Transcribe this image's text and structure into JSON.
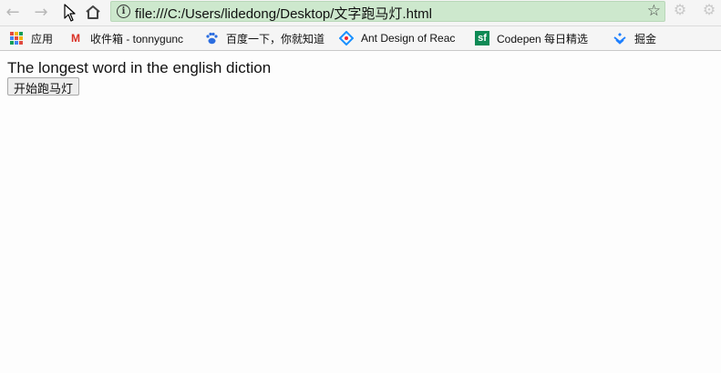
{
  "browser": {
    "url": "file:///C:/Users/lidedong/Desktop/文字跑马灯.html",
    "icons": {
      "back": "arrow-left-icon",
      "forward": "arrow-right-icon",
      "reload": "reload-icon",
      "home": "home-icon",
      "info": "info-icon",
      "star": "star-icon",
      "extension": "gear-icon"
    }
  },
  "bookmarks": [
    {
      "label": "应用",
      "icon": "apps-grid-icon"
    },
    {
      "label": "收件箱 - tonnygunc",
      "icon": "gmail-icon",
      "icon_text": "M",
      "icon_color": "#d93025"
    },
    {
      "label": "百度一下，你就知道",
      "icon": "baidu-paw-icon",
      "icon_color": "#2b6de0"
    },
    {
      "label": "Ant Design of Reac",
      "icon": "ant-design-icon",
      "icon_color": "#1890ff"
    },
    {
      "label": "Codepen 每日精选",
      "icon": "sf-icon",
      "icon_text": "sf",
      "icon_color": "#0e8a55"
    },
    {
      "label": "掘金",
      "icon": "juejin-icon",
      "icon_color": "#1e80ff"
    }
  ],
  "page": {
    "marquee_text": "The longest word in the english diction",
    "start_button": "开始跑马灯"
  },
  "colors": {
    "omnibox_bg": "#cde8cd",
    "toolbar_bg": "#f5f5f5"
  }
}
